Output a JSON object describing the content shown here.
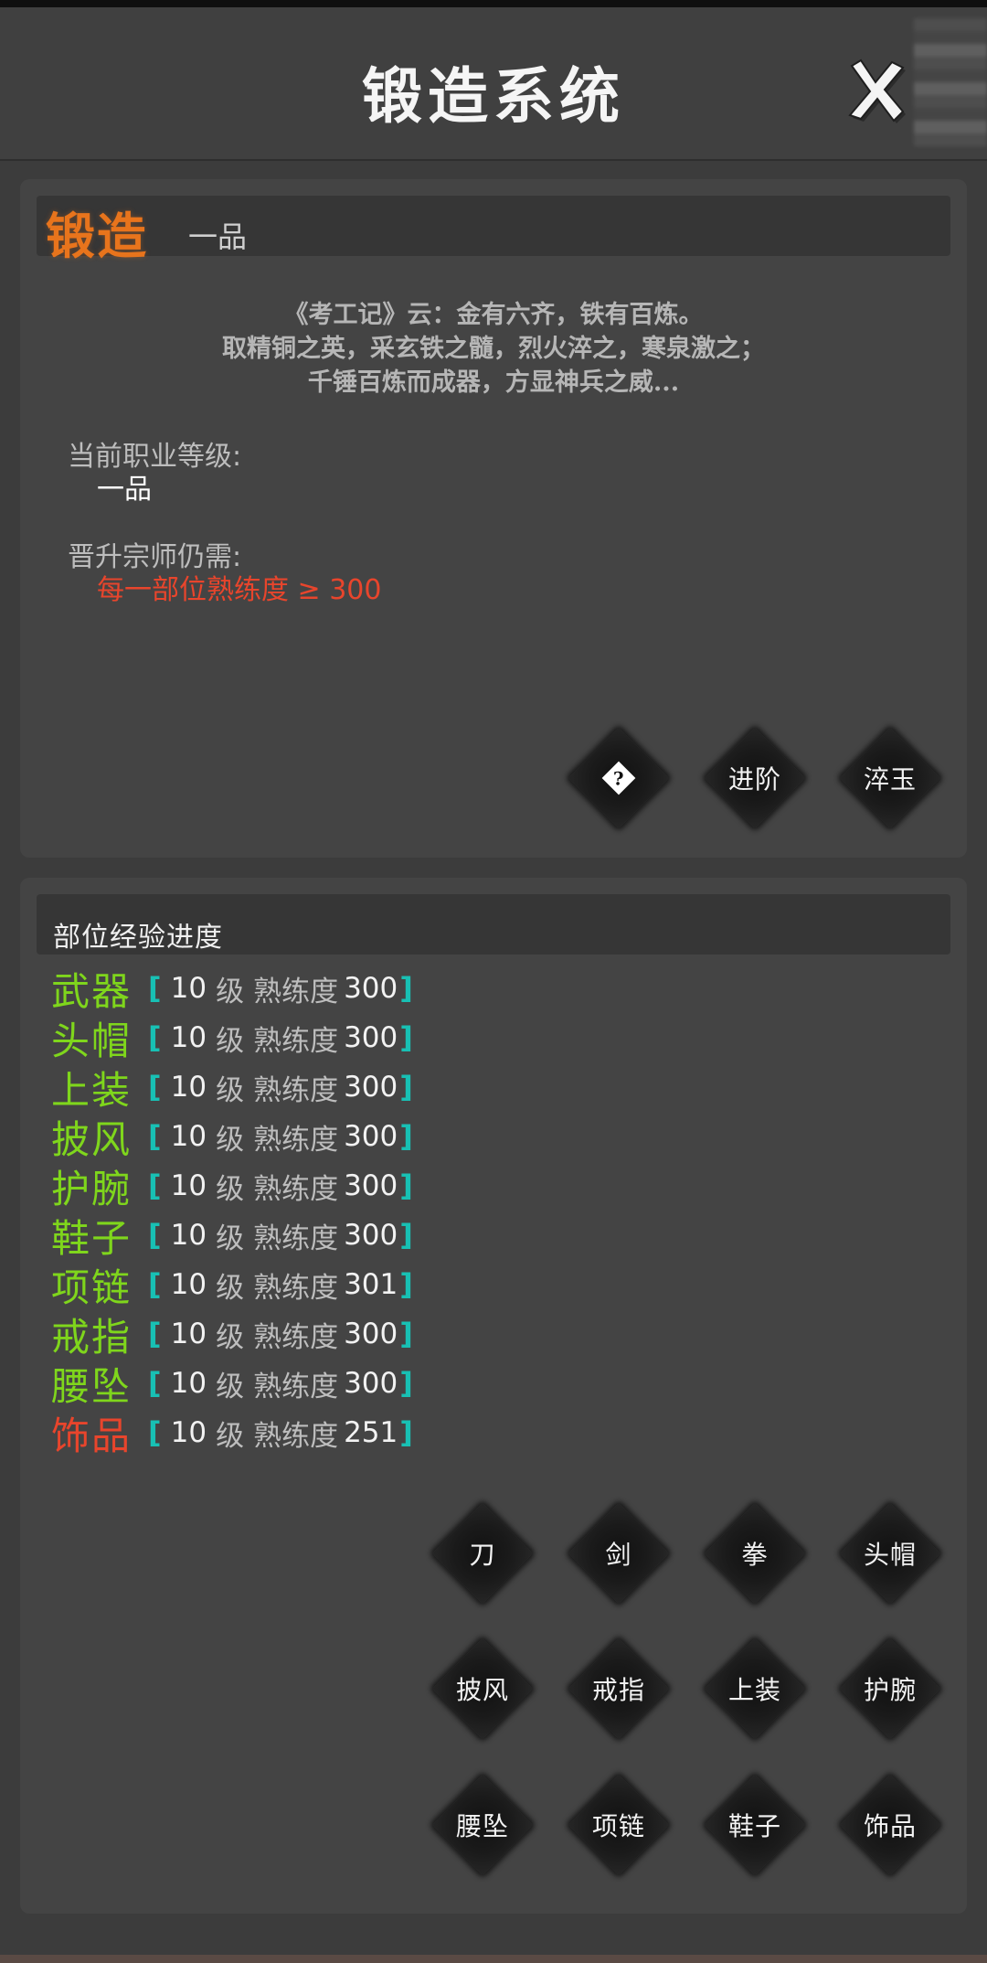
{
  "header": {
    "title": "锻造系统",
    "close_icon": "close-x-icon"
  },
  "forge": {
    "badge": "锻造",
    "grade_tab": "一品",
    "quote": [
      "《考工记》云：金有六齐，铁有百炼。",
      "取精铜之英，采玄铁之髓，烈火淬之，寒泉激之；",
      "千锤百炼而成器，方显神兵之威..."
    ],
    "current_level_label": "当前职业等级:",
    "current_level_value": "一品",
    "promote_label": "晋升宗师仍需:",
    "promote_requirement": "每一部位熟练度 ≥ 300",
    "buttons": {
      "help": "?",
      "advance": "进阶",
      "temper": "淬玉"
    }
  },
  "progress": {
    "title": "部位经验进度",
    "level_unit": "级",
    "prof_label": "熟练度",
    "rows": [
      {
        "name": "武器",
        "level": "10",
        "prof": "300"
      },
      {
        "name": "头帽",
        "level": "10",
        "prof": "300"
      },
      {
        "name": "上装",
        "level": "10",
        "prof": "300"
      },
      {
        "name": "披风",
        "level": "10",
        "prof": "300"
      },
      {
        "name": "护腕",
        "level": "10",
        "prof": "300"
      },
      {
        "name": "鞋子",
        "level": "10",
        "prof": "300"
      },
      {
        "name": "项链",
        "level": "10",
        "prof": "301"
      },
      {
        "name": "戒指",
        "level": "10",
        "prof": "300"
      },
      {
        "name": "腰坠",
        "level": "10",
        "prof": "300"
      },
      {
        "name": "饰品",
        "level": "10",
        "prof": "251"
      }
    ],
    "part_buttons": [
      "刀",
      "剑",
      "拳",
      "头帽",
      "披风",
      "戒指",
      "上装",
      "护腕",
      "腰坠",
      "项链",
      "鞋子",
      "饰品"
    ]
  },
  "colors": {
    "complete": "#7fd61c",
    "incomplete": "#e8452c",
    "bracket": "#18c0b4",
    "badge": "#e8741c"
  }
}
